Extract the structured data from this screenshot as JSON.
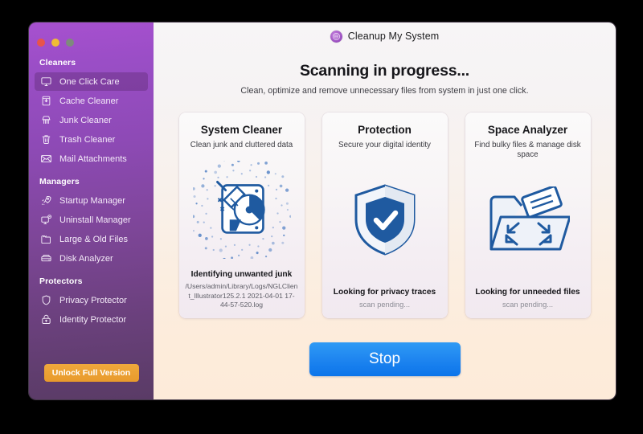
{
  "window": {
    "traffic_lights": [
      "close",
      "minimize",
      "zoom"
    ],
    "app_title": "Cleanup My System",
    "logo_icon": "cleanup-my-system-logo"
  },
  "sidebar": {
    "sections": [
      {
        "title": "Cleaners",
        "items": [
          {
            "label": "One Click Care",
            "icon": "monitor-icon",
            "selected": true
          },
          {
            "label": "Cache Cleaner",
            "icon": "cache-box-icon",
            "selected": false
          },
          {
            "label": "Junk Cleaner",
            "icon": "brush-icon",
            "selected": false
          },
          {
            "label": "Trash Cleaner",
            "icon": "trash-icon",
            "selected": false
          },
          {
            "label": "Mail Attachments",
            "icon": "envelope-icon",
            "selected": false
          }
        ]
      },
      {
        "title": "Managers",
        "items": [
          {
            "label": "Startup Manager",
            "icon": "rocket-icon",
            "selected": false
          },
          {
            "label": "Uninstall Manager",
            "icon": "app-remove-icon",
            "selected": false
          },
          {
            "label": "Large & Old Files",
            "icon": "folder-icon",
            "selected": false
          },
          {
            "label": "Disk Analyzer",
            "icon": "disk-icon",
            "selected": false
          }
        ]
      },
      {
        "title": "Protectors",
        "items": [
          {
            "label": "Privacy Protector",
            "icon": "shield-icon",
            "selected": false
          },
          {
            "label": "Identity Protector",
            "icon": "lock-icon",
            "selected": false
          }
        ]
      }
    ],
    "unlock_button": "Unlock Full Version"
  },
  "main": {
    "headline": "Scanning in progress...",
    "subline": "Clean, optimize and remove unnecessary files from system in just one click.",
    "cards": [
      {
        "title": "System Cleaner",
        "subtitle": "Clean junk and cluttered data",
        "icon": "broom-disk-icon",
        "status": "Identifying unwanted junk",
        "detail": "/Users/admin/Library/Logs/NGLClient_Illustrator125.2.1 2021-04-01 17-44-57-520.log",
        "pending": false
      },
      {
        "title": "Protection",
        "subtitle": "Secure your digital identity",
        "icon": "shield-check-icon",
        "status": "Looking for privacy traces",
        "detail": "scan pending...",
        "pending": true
      },
      {
        "title": "Space Analyzer",
        "subtitle": "Find bulky files & manage disk space",
        "icon": "folder-expand-icon",
        "status": "Looking for unneeded files",
        "detail": "scan pending...",
        "pending": true
      }
    ],
    "stop_button": "Stop"
  },
  "colors": {
    "sidebar_top": "#a750cf",
    "sidebar_bottom": "#5a3b66",
    "accent_blue": "#1f86f0",
    "accent_orange": "#e89a2c",
    "icon_blue": "#1f5aa0"
  }
}
